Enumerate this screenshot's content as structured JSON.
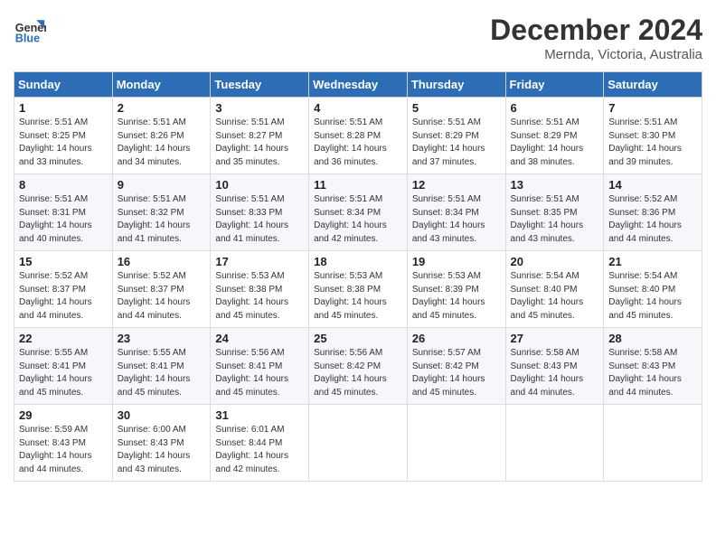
{
  "header": {
    "logo_line1": "General",
    "logo_line2": "Blue",
    "month": "December 2024",
    "location": "Mernda, Victoria, Australia"
  },
  "days_of_week": [
    "Sunday",
    "Monday",
    "Tuesday",
    "Wednesday",
    "Thursday",
    "Friday",
    "Saturday"
  ],
  "weeks": [
    [
      {
        "day": "1",
        "sunrise": "5:51 AM",
        "sunset": "8:25 PM",
        "daylight": "14 hours and 33 minutes."
      },
      {
        "day": "2",
        "sunrise": "5:51 AM",
        "sunset": "8:26 PM",
        "daylight": "14 hours and 34 minutes."
      },
      {
        "day": "3",
        "sunrise": "5:51 AM",
        "sunset": "8:27 PM",
        "daylight": "14 hours and 35 minutes."
      },
      {
        "day": "4",
        "sunrise": "5:51 AM",
        "sunset": "8:28 PM",
        "daylight": "14 hours and 36 minutes."
      },
      {
        "day": "5",
        "sunrise": "5:51 AM",
        "sunset": "8:29 PM",
        "daylight": "14 hours and 37 minutes."
      },
      {
        "day": "6",
        "sunrise": "5:51 AM",
        "sunset": "8:29 PM",
        "daylight": "14 hours and 38 minutes."
      },
      {
        "day": "7",
        "sunrise": "5:51 AM",
        "sunset": "8:30 PM",
        "daylight": "14 hours and 39 minutes."
      }
    ],
    [
      {
        "day": "8",
        "sunrise": "5:51 AM",
        "sunset": "8:31 PM",
        "daylight": "14 hours and 40 minutes."
      },
      {
        "day": "9",
        "sunrise": "5:51 AM",
        "sunset": "8:32 PM",
        "daylight": "14 hours and 41 minutes."
      },
      {
        "day": "10",
        "sunrise": "5:51 AM",
        "sunset": "8:33 PM",
        "daylight": "14 hours and 41 minutes."
      },
      {
        "day": "11",
        "sunrise": "5:51 AM",
        "sunset": "8:34 PM",
        "daylight": "14 hours and 42 minutes."
      },
      {
        "day": "12",
        "sunrise": "5:51 AM",
        "sunset": "8:34 PM",
        "daylight": "14 hours and 43 minutes."
      },
      {
        "day": "13",
        "sunrise": "5:51 AM",
        "sunset": "8:35 PM",
        "daylight": "14 hours and 43 minutes."
      },
      {
        "day": "14",
        "sunrise": "5:52 AM",
        "sunset": "8:36 PM",
        "daylight": "14 hours and 44 minutes."
      }
    ],
    [
      {
        "day": "15",
        "sunrise": "5:52 AM",
        "sunset": "8:37 PM",
        "daylight": "14 hours and 44 minutes."
      },
      {
        "day": "16",
        "sunrise": "5:52 AM",
        "sunset": "8:37 PM",
        "daylight": "14 hours and 44 minutes."
      },
      {
        "day": "17",
        "sunrise": "5:53 AM",
        "sunset": "8:38 PM",
        "daylight": "14 hours and 45 minutes."
      },
      {
        "day": "18",
        "sunrise": "5:53 AM",
        "sunset": "8:38 PM",
        "daylight": "14 hours and 45 minutes."
      },
      {
        "day": "19",
        "sunrise": "5:53 AM",
        "sunset": "8:39 PM",
        "daylight": "14 hours and 45 minutes."
      },
      {
        "day": "20",
        "sunrise": "5:54 AM",
        "sunset": "8:40 PM",
        "daylight": "14 hours and 45 minutes."
      },
      {
        "day": "21",
        "sunrise": "5:54 AM",
        "sunset": "8:40 PM",
        "daylight": "14 hours and 45 minutes."
      }
    ],
    [
      {
        "day": "22",
        "sunrise": "5:55 AM",
        "sunset": "8:41 PM",
        "daylight": "14 hours and 45 minutes."
      },
      {
        "day": "23",
        "sunrise": "5:55 AM",
        "sunset": "8:41 PM",
        "daylight": "14 hours and 45 minutes."
      },
      {
        "day": "24",
        "sunrise": "5:56 AM",
        "sunset": "8:41 PM",
        "daylight": "14 hours and 45 minutes."
      },
      {
        "day": "25",
        "sunrise": "5:56 AM",
        "sunset": "8:42 PM",
        "daylight": "14 hours and 45 minutes."
      },
      {
        "day": "26",
        "sunrise": "5:57 AM",
        "sunset": "8:42 PM",
        "daylight": "14 hours and 45 minutes."
      },
      {
        "day": "27",
        "sunrise": "5:58 AM",
        "sunset": "8:43 PM",
        "daylight": "14 hours and 44 minutes."
      },
      {
        "day": "28",
        "sunrise": "5:58 AM",
        "sunset": "8:43 PM",
        "daylight": "14 hours and 44 minutes."
      }
    ],
    [
      {
        "day": "29",
        "sunrise": "5:59 AM",
        "sunset": "8:43 PM",
        "daylight": "14 hours and 44 minutes."
      },
      {
        "day": "30",
        "sunrise": "6:00 AM",
        "sunset": "8:43 PM",
        "daylight": "14 hours and 43 minutes."
      },
      {
        "day": "31",
        "sunrise": "6:01 AM",
        "sunset": "8:44 PM",
        "daylight": "14 hours and 42 minutes."
      },
      null,
      null,
      null,
      null
    ]
  ]
}
